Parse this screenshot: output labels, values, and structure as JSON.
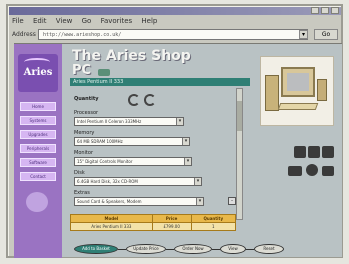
{
  "menu": [
    "File",
    "Edit",
    "View",
    "Go",
    "Favorites",
    "Help"
  ],
  "address": {
    "label": "Address",
    "url": "http://www.arieshop.co.uk/",
    "go_label": "Go"
  },
  "brand": {
    "logo": "Aries"
  },
  "sidebar": {
    "items": [
      "Home",
      "Systems",
      "Upgrades",
      "Peripherals",
      "Software",
      "Contact"
    ]
  },
  "page": {
    "title": "The Aries Shop",
    "subtitle": "PC",
    "banner": "Aries Pentium II 333",
    "quantity_label": "Quantity",
    "fields": [
      {
        "label": "Processor",
        "value": "Intel Pentium II Celeron 333MHz"
      },
      {
        "label": "Memory",
        "value": "64 MB SDRAM 100MHz"
      },
      {
        "label": "Monitor",
        "value": "15\" Digital Controls Monitor"
      },
      {
        "label": "Disk",
        "value": "6.4GB Hard Disk, 32x CD-ROM"
      },
      {
        "label": "Extras",
        "value": "Sound Card & Speakers, Modem"
      }
    ]
  },
  "table": {
    "headers": [
      "Model",
      "Price",
      "Quantity"
    ],
    "row": [
      "Aries Pentium II 333",
      "£799.00",
      "1"
    ]
  },
  "buttons": [
    "Add to Basket",
    "Update Price",
    "Order Now",
    "View",
    "Reset"
  ],
  "colors": {
    "sidebar": "#9a73c2",
    "accent": "#2f7f75",
    "table_header": "#e8b84a"
  },
  "icons": [
    "back-icon",
    "forward-icon",
    "stop-icon",
    "refresh-icon",
    "home-icon",
    "search-icon"
  ]
}
